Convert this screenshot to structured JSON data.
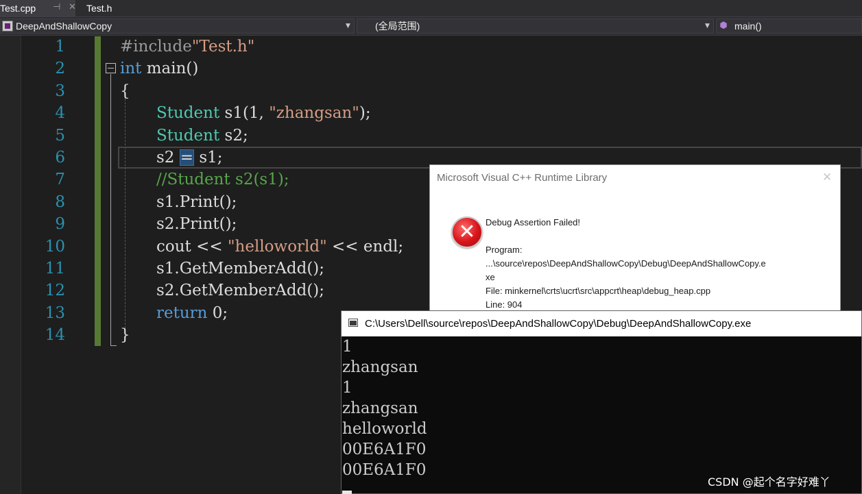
{
  "tabs": [
    {
      "label": "Test.cpp",
      "active": true
    },
    {
      "label": "Test.h",
      "active": false
    }
  ],
  "tab_glyphs": {
    "pin": "⊣",
    "close": "✕"
  },
  "navbar": {
    "project": "DeepAndShallowCopy",
    "scope": "(全局范围)",
    "member": "main()",
    "dropdown_arrow": "▼",
    "member_icon": "⬢"
  },
  "editor": {
    "line_numbers": [
      "1",
      "2",
      "3",
      "4",
      "5",
      "6",
      "7",
      "8",
      "9",
      "10",
      "11",
      "12",
      "13",
      "14"
    ],
    "lines": [
      [
        {
          "t": "#include",
          "c": "pre"
        },
        {
          "t": "\"Test.h\"",
          "c": "str"
        }
      ],
      [
        {
          "t": "int",
          "c": "kw"
        },
        {
          "t": " main()",
          "c": "txt"
        }
      ],
      [
        {
          "t": "{",
          "c": "txt"
        }
      ],
      [
        {
          "t": "Student",
          "c": "type"
        },
        {
          "t": " s1(1, ",
          "c": "txt"
        },
        {
          "t": "\"zhangsan\"",
          "c": "str"
        },
        {
          "t": ");",
          "c": "txt"
        }
      ],
      [
        {
          "t": "Student",
          "c": "type"
        },
        {
          "t": " s2;",
          "c": "txt"
        }
      ],
      [
        {
          "t": "s2 ",
          "c": "txt"
        },
        {
          "t": "=",
          "c": "eq"
        },
        {
          "t": " s1;",
          "c": "txt"
        }
      ],
      [
        {
          "t": "//Student s2(s1);",
          "c": "cmt"
        }
      ],
      [
        {
          "t": "s1.Print();",
          "c": "txt"
        }
      ],
      [
        {
          "t": "s2.Print();",
          "c": "txt"
        }
      ],
      [
        {
          "t": "cout << ",
          "c": "txt"
        },
        {
          "t": "\"helloworld\"",
          "c": "str"
        },
        {
          "t": " << endl;",
          "c": "txt"
        }
      ],
      [
        {
          "t": "s1.GetMemberAdd();",
          "c": "txt"
        }
      ],
      [
        {
          "t": "s2.GetMemberAdd();",
          "c": "txt"
        }
      ],
      [
        {
          "t": "return",
          "c": "kw"
        },
        {
          "t": " 0;",
          "c": "txt"
        }
      ],
      [
        {
          "t": "}",
          "c": "txt"
        }
      ]
    ]
  },
  "dialog": {
    "title": "Microsoft Visual C++ Runtime Library",
    "close_glyph": "✕",
    "icon_glyph": "✕",
    "heading": "Debug Assertion Failed!",
    "program_label": "Program:",
    "program_path_1": "...\\source\\repos\\DeepAndShallowCopy\\Debug\\DeepAndShallowCopy.e",
    "program_path_2": "xe",
    "file": "File: minkernel\\crts\\ucrt\\src\\appcrt\\heap\\debug_heap.cpp",
    "line": "Line: 904"
  },
  "console": {
    "title": "C:\\Users\\Dell\\source\\repos\\DeepAndShallowCopy\\Debug\\DeepAndShallowCopy.exe",
    "output": [
      "1",
      "zhangsan",
      "1",
      "zhangsan",
      "helloworld",
      "00E6A1F0",
      "00E6A1F0"
    ]
  },
  "watermark": "CSDN @起个名字好难丫"
}
